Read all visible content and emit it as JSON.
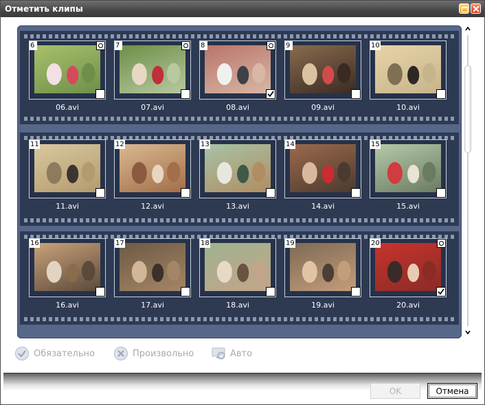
{
  "window": {
    "title": "Отметить клипы"
  },
  "colors": {
    "filmstrip_outer": "#56678a",
    "filmstrip_inner": "#2e3a52",
    "clip_border": "#c9d2e2",
    "label_text": "#ffffff",
    "disabled_text": "#a9a9a9"
  },
  "clips": [
    {
      "number": "6",
      "label": "06.avi",
      "checked": false,
      "has_icon": true,
      "colors": [
        "#a8c06c",
        "#f3dfe4",
        "#d5495b",
        "#6e8f49"
      ]
    },
    {
      "number": "7",
      "label": "07.avi",
      "checked": false,
      "has_icon": true,
      "colors": [
        "#6d8f48",
        "#e7d8c6",
        "#c02f3a",
        "#b8c9a0"
      ]
    },
    {
      "number": "8",
      "label": "08.avi",
      "checked": true,
      "has_icon": true,
      "colors": [
        "#b8756b",
        "#f0f0f0",
        "#3f4146",
        "#d8b7a4"
      ]
    },
    {
      "number": "9",
      "label": "09.avi",
      "checked": false,
      "has_icon": false,
      "colors": [
        "#8a6b4e",
        "#dbc2a1",
        "#d14b4c",
        "#3a2b22"
      ]
    },
    {
      "number": "10",
      "label": "10.avi",
      "checked": false,
      "has_icon": false,
      "colors": [
        "#e7d3a7",
        "#7f6f55",
        "#2d2824",
        "#c8b48c"
      ]
    },
    {
      "number": "11",
      "label": "11.avi",
      "checked": false,
      "has_icon": false,
      "colors": [
        "#d9c79d",
        "#8c7b5c",
        "#3b3530",
        "#b39b6f"
      ]
    },
    {
      "number": "12",
      "label": "12.avi",
      "checked": false,
      "has_icon": false,
      "colors": [
        "#d9b88f",
        "#8b5b3f",
        "#e9d6c0",
        "#a36e4a"
      ]
    },
    {
      "number": "13",
      "label": "13.avi",
      "checked": false,
      "has_icon": false,
      "colors": [
        "#a7c2a6",
        "#e6e8de",
        "#3d5a48",
        "#b08e62"
      ]
    },
    {
      "number": "14",
      "label": "14.avi",
      "checked": false,
      "has_icon": false,
      "colors": [
        "#9c6a4b",
        "#d8b9a0",
        "#cc2b33",
        "#4b3a30"
      ]
    },
    {
      "number": "15",
      "label": "15.avi",
      "checked": false,
      "has_icon": false,
      "colors": [
        "#b5c9a8",
        "#d23b3f",
        "#e8e3d3",
        "#6b7b62"
      ]
    },
    {
      "number": "16",
      "label": "16.avi",
      "checked": false,
      "has_icon": false,
      "colors": [
        "#c9a27a",
        "#e2d4c1",
        "#8a6c4d",
        "#5b4a3a"
      ]
    },
    {
      "number": "17",
      "label": "17.avi",
      "checked": false,
      "has_icon": false,
      "colors": [
        "#6e5a45",
        "#d2b69a",
        "#3b302a",
        "#a48666"
      ]
    },
    {
      "number": "18",
      "label": "18.avi",
      "checked": false,
      "has_icon": false,
      "colors": [
        "#9fb38f",
        "#e7d9c6",
        "#6b5341",
        "#c3a48a"
      ]
    },
    {
      "number": "19",
      "label": "19.avi",
      "checked": false,
      "has_icon": false,
      "colors": [
        "#7e6a55",
        "#e1c4a6",
        "#4b3f35",
        "#c49d7a"
      ]
    },
    {
      "number": "20",
      "label": "20.avi",
      "checked": true,
      "has_icon": true,
      "colors": [
        "#c7342c",
        "#3a2a28",
        "#e9cbb5",
        "#8a2b26"
      ]
    }
  ],
  "modes": {
    "required": {
      "label": "Обязательно",
      "icon": "check-circle-icon"
    },
    "optional": {
      "label": "Произвольно",
      "icon": "x-circle-icon"
    },
    "auto": {
      "label": "Авто",
      "icon": "monitor-auto-icon"
    }
  },
  "buttons": {
    "ok": "OK",
    "cancel": "Отмена"
  }
}
